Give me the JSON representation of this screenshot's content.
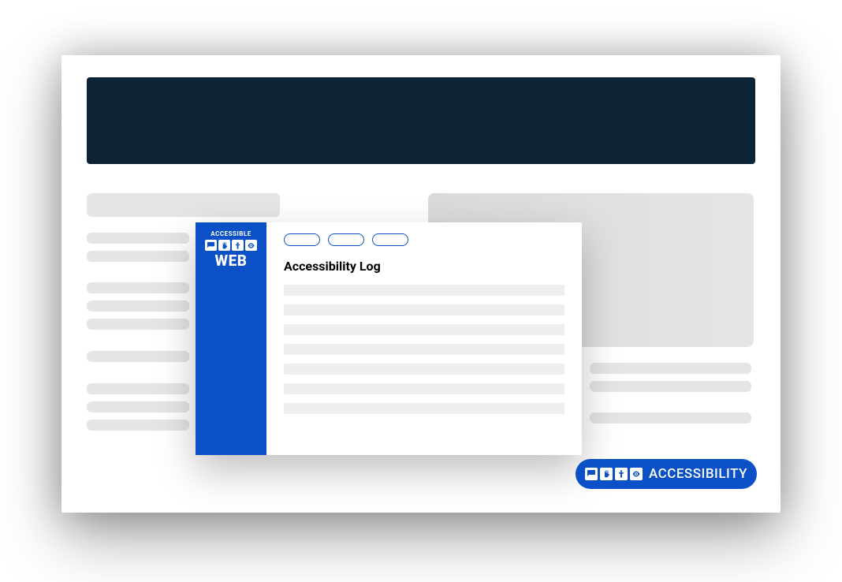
{
  "logo": {
    "top_text": "ACCESSIBLE",
    "bottom_text": "WEB",
    "icons": [
      "speech-icon",
      "hand-icon",
      "person-icon",
      "eye-icon"
    ]
  },
  "popup": {
    "title": "Accessibility Log"
  },
  "badge": {
    "label": "ACCESSIBILITY",
    "icons": [
      "speech-icon",
      "hand-icon",
      "person-icon",
      "eye-icon"
    ]
  },
  "colors": {
    "header": "#0d2436",
    "brand": "#0b50c7",
    "skeleton": "#e5e5e5",
    "log_line": "#eeeeee"
  }
}
